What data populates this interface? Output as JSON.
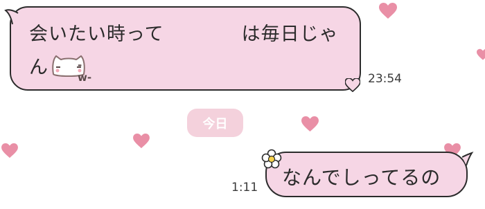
{
  "messages": {
    "incoming": {
      "line1": "会いたい時って　　　　は毎日じゃ",
      "line2": "ん",
      "sticker": "-w-",
      "time": "23:54"
    },
    "date_divider": "今日",
    "outgoing": {
      "text": "なんでしってるの",
      "time": "1:11"
    }
  },
  "colors": {
    "bubble": "#f6d6e5",
    "heart": "#e98fa6",
    "date_pill": "#f4d1dc",
    "outline": "#2b2b2b"
  },
  "icons": [
    "heart-icon",
    "flower-icon",
    "cat-sticker-icon"
  ]
}
